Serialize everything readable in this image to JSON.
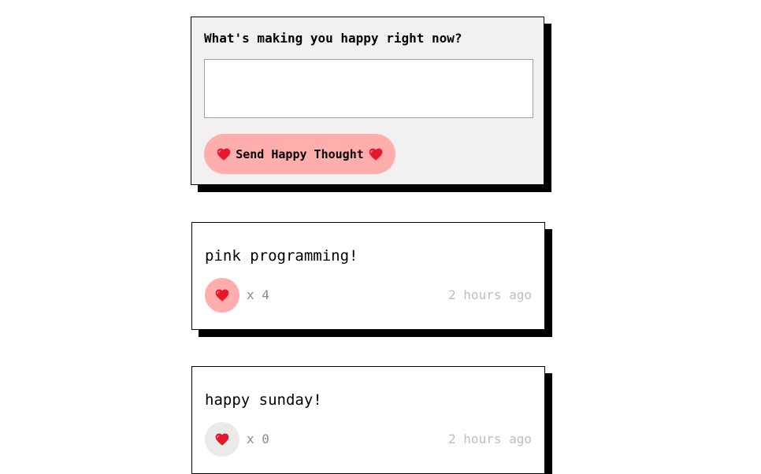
{
  "form": {
    "title": "What's making you happy right now?",
    "input_value": "",
    "submit_label": "Send Happy Thought"
  },
  "thoughts": [
    {
      "message": "pink programming!",
      "likes": "x 4",
      "time": "2 hours ago",
      "liked": true
    },
    {
      "message": "happy sunday!",
      "likes": "x 0",
      "time": "2 hours ago",
      "liked": false
    }
  ],
  "colors": {
    "accent_pink": "#ffadad",
    "form_background": "#f2f0f0",
    "unliked_background": "#eaeaea",
    "heart_red": "#e8182c"
  },
  "icons": {
    "heart": "heart-icon"
  }
}
